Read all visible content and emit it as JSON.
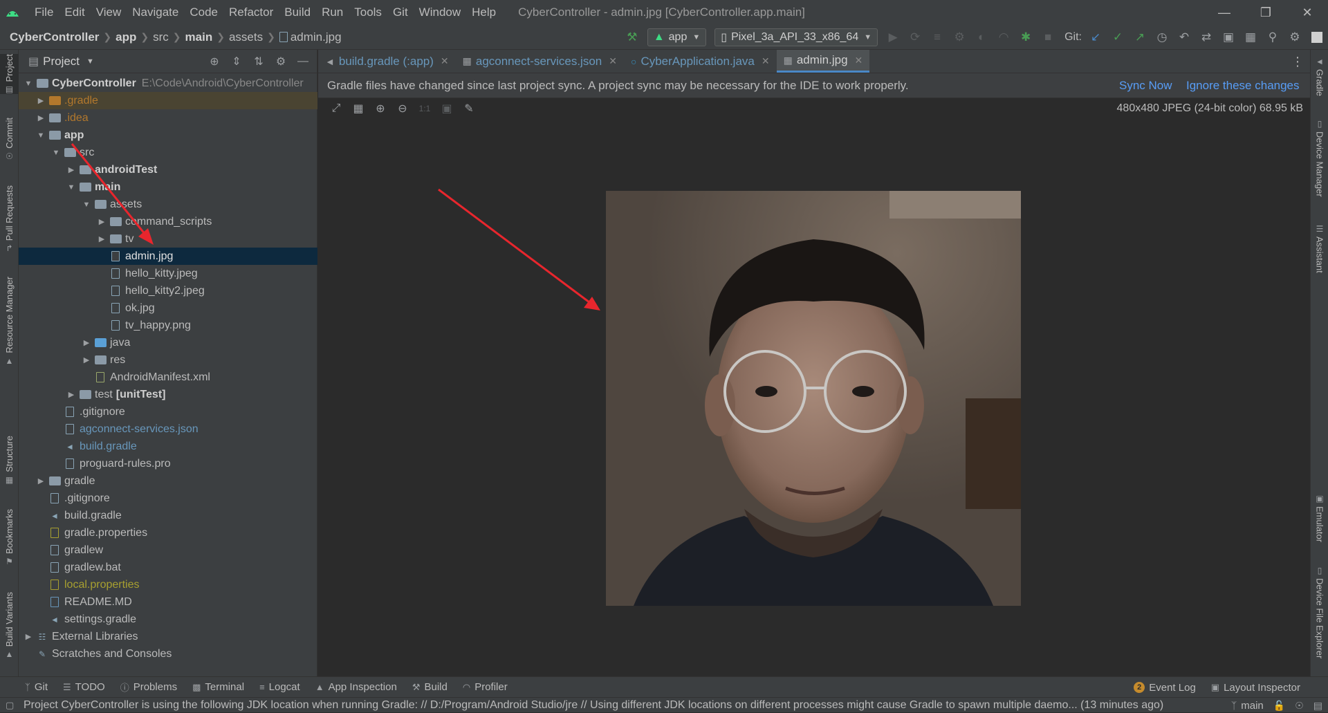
{
  "menu": [
    "File",
    "Edit",
    "View",
    "Navigate",
    "Code",
    "Refactor",
    "Build",
    "Run",
    "Tools",
    "Git",
    "Window",
    "Help"
  ],
  "window_title": "CyberController - admin.jpg [CyberController.app.main]",
  "breadcrumb": [
    "CyberController",
    "app",
    "src",
    "main",
    "assets",
    "admin.jpg"
  ],
  "run_config": "app",
  "device": "Pixel_3a_API_33_x86_64",
  "git_label": "Git:",
  "project_panel": {
    "title": "Project",
    "root_name": "CyberController",
    "root_path": "E:\\Code\\Android\\CyberController",
    "tree": [
      {
        "label": ".gradle",
        "color": "#b3782c"
      },
      {
        "label": ".idea",
        "color": "#b3782c"
      },
      {
        "label": "app"
      },
      {
        "label": "src"
      },
      {
        "label": "androidTest"
      },
      {
        "label": "main"
      },
      {
        "label": "assets"
      },
      {
        "label": "command_scripts"
      },
      {
        "label": "tv"
      },
      {
        "label": "admin.jpg"
      },
      {
        "label": "hello_kitty.jpeg"
      },
      {
        "label": "hello_kitty2.jpeg"
      },
      {
        "label": "ok.jpg"
      },
      {
        "label": "tv_happy.png"
      },
      {
        "label": "java"
      },
      {
        "label": "res"
      },
      {
        "label": "AndroidManifest.xml"
      },
      {
        "label": "test",
        "bold_suffix": "[unitTest]"
      },
      {
        "label": ".gitignore"
      },
      {
        "label": "agconnect-services.json",
        "color": "#6897bb"
      },
      {
        "label": "build.gradle",
        "color": "#6897bb"
      },
      {
        "label": "proguard-rules.pro"
      },
      {
        "label": "gradle"
      },
      {
        "label": ".gitignore"
      },
      {
        "label": "build.gradle"
      },
      {
        "label": "gradle.properties"
      },
      {
        "label": "gradlew"
      },
      {
        "label": "gradlew.bat"
      },
      {
        "label": "local.properties",
        "color": "#a8a030"
      },
      {
        "label": "README.MD"
      },
      {
        "label": "settings.gradle"
      },
      {
        "label": "External Libraries"
      },
      {
        "label": "Scratches and Consoles"
      }
    ]
  },
  "tabs": [
    {
      "label": "build.gradle (:app)"
    },
    {
      "label": "agconnect-services.json"
    },
    {
      "label": "CyberApplication.java"
    },
    {
      "label": "admin.jpg"
    }
  ],
  "banner": {
    "text": "Gradle files have changed since last project sync. A project sync may be necessary for the IDE to work properly.",
    "sync": "Sync Now",
    "ignore": "Ignore these changes"
  },
  "image_info": "480x480 JPEG (24-bit color) 68.95 kB",
  "left_stripe": [
    "Project",
    "Commit",
    "Pull Requests",
    "Resource Manager",
    "Structure",
    "Bookmarks",
    "Build Variants"
  ],
  "right_stripe": [
    "Gradle",
    "Device Manager",
    "Assistant",
    "Emulator",
    "Device File Explorer"
  ],
  "bottom_tools": [
    "Git",
    "TODO",
    "Problems",
    "Terminal",
    "Logcat",
    "App Inspection",
    "Build",
    "Profiler"
  ],
  "event_log": {
    "count": "2",
    "label": "Event Log"
  },
  "layout_inspector": "Layout Inspector",
  "status_message": "Project CyberController is using the following JDK location when running Gradle: // D:/Program/Android Studio/jre // Using different JDK locations on different processes might cause Gradle to spawn multiple daemo... (13 minutes ago)",
  "branch": "main",
  "accent_color": "#4a88c7",
  "selection_color": "#0d293e",
  "annotation_color": "#e8262d"
}
